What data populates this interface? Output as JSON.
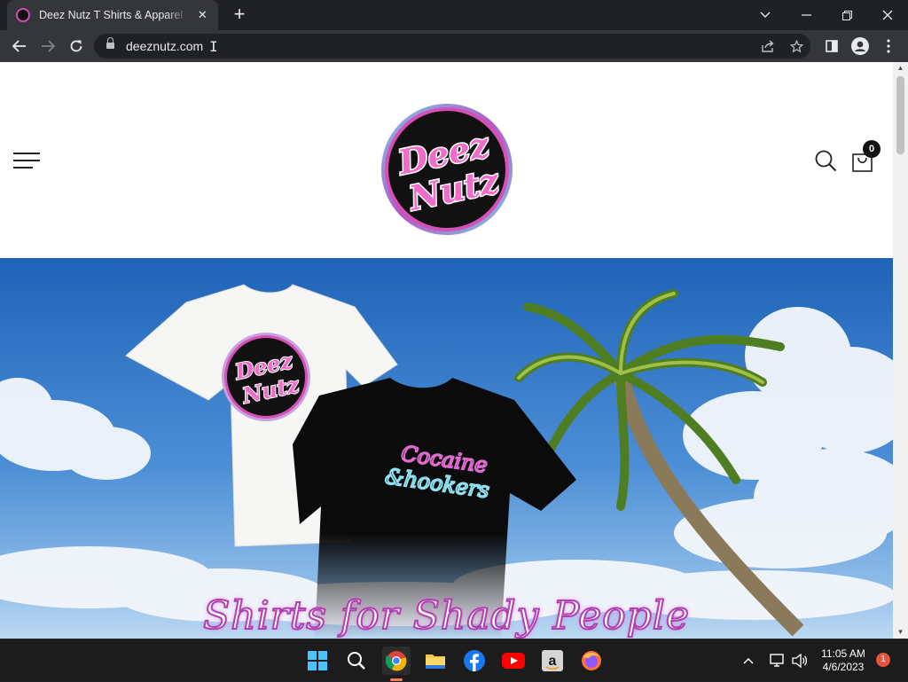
{
  "browser": {
    "tab": {
      "title": "Deez Nutz T Shirts & Apparel - O",
      "close_icon": "✕"
    },
    "new_tab_icon": "+",
    "window_controls": {
      "menu": "⌄",
      "minimize": "—",
      "restore": "❐",
      "close": "✕"
    },
    "url": "deeznutz.com",
    "nav": {
      "back": "←",
      "forward": "→",
      "reload": "↻"
    }
  },
  "site": {
    "logo": {
      "line1": "Deez",
      "line2": "Nutz"
    },
    "cart_count": "0",
    "hero": {
      "shirt_white_logo": {
        "line1": "Deez",
        "line2": "Nutz"
      },
      "shirt_black_text": {
        "line1": "Cocaine",
        "line2": "&hookers"
      },
      "tagline": "Shirts for Shady People"
    }
  },
  "taskbar": {
    "time": "11:05 AM",
    "date": "4/6/2023",
    "notifications": "1"
  },
  "colors": {
    "brand_pink": "#d64fb4",
    "brand_blue": "#7cc8e8",
    "chrome_dark": "#202124",
    "chrome_toolbar": "#35363a"
  }
}
